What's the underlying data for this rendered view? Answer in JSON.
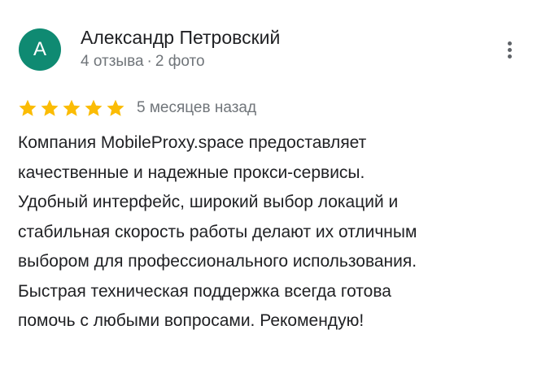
{
  "review": {
    "author": {
      "avatar_letter": "A",
      "avatar_color": "#0f8a72",
      "name": "Александр Петровский",
      "reviews_count": "4 отзыва",
      "separator": "·",
      "photos_count": "2 фото"
    },
    "menu_icon": "more-vertical-icon",
    "rating": {
      "stars": 5,
      "max": 5,
      "star_color": "#fbbc04",
      "star_icon": "star-icon"
    },
    "date": "5 месяцев назад",
    "text_lines": [
      "Компания MobileProxy.space предоставляет",
      "качественные и надежные прокси-сервисы.",
      "Удобный интерфейс, широкий выбор локаций и",
      "стабильная скорость работы делают их отличным",
      "выбором для профессионального использования.",
      "Быстрая техническая поддержка всегда готова",
      "помочь с любыми вопросами. Рекомендую!"
    ]
  }
}
